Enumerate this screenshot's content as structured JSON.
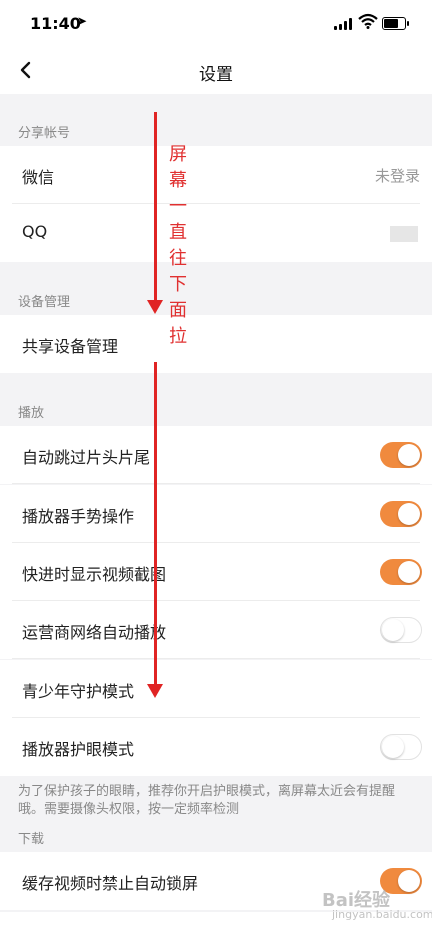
{
  "status_bar": {
    "time": "11:40",
    "location_arrow": "location-arrow-icon",
    "battery_level": 0.75
  },
  "header": {
    "title": "设置",
    "back_icon": "back-chevron-icon"
  },
  "sections": {
    "share_accounts": {
      "header": "分享帐号",
      "items": [
        {
          "label": "微信",
          "value": "未登录"
        },
        {
          "label": "QQ",
          "value": ""
        }
      ]
    },
    "device_management": {
      "header": "设备管理",
      "items": [
        {
          "label": "共享设备管理"
        }
      ]
    },
    "playback": {
      "header": "播放",
      "items": [
        {
          "label": "自动跳过片头片尾",
          "on": true
        },
        {
          "label": "播放器手势操作",
          "on": true
        },
        {
          "label": "快进时显示视频截图",
          "on": true
        },
        {
          "label": "运营商网络自动播放",
          "on": false
        },
        {
          "label": "青少年守护模式"
        },
        {
          "label": "播放器护眼模式",
          "on": false
        }
      ],
      "note": "为了保护孩子的眼睛，推荐你开启护眼模式，离屏幕太近会有提醒哦。需要摄像头权限，按一定频率检测"
    },
    "download": {
      "header": "下载",
      "items": [
        {
          "label": "缓存视频时禁止自动锁屏",
          "on": true
        }
      ]
    }
  },
  "annotation": {
    "text": [
      "屏",
      "幕",
      "一",
      "直",
      "往",
      "下",
      "面",
      "拉"
    ]
  },
  "watermark": {
    "text": "Bai经验",
    "sub": "jingyan.baidu.com"
  },
  "colors": {
    "accent": "#f08a3e",
    "annotation": "#e02424",
    "background": "#f3f3f5"
  }
}
